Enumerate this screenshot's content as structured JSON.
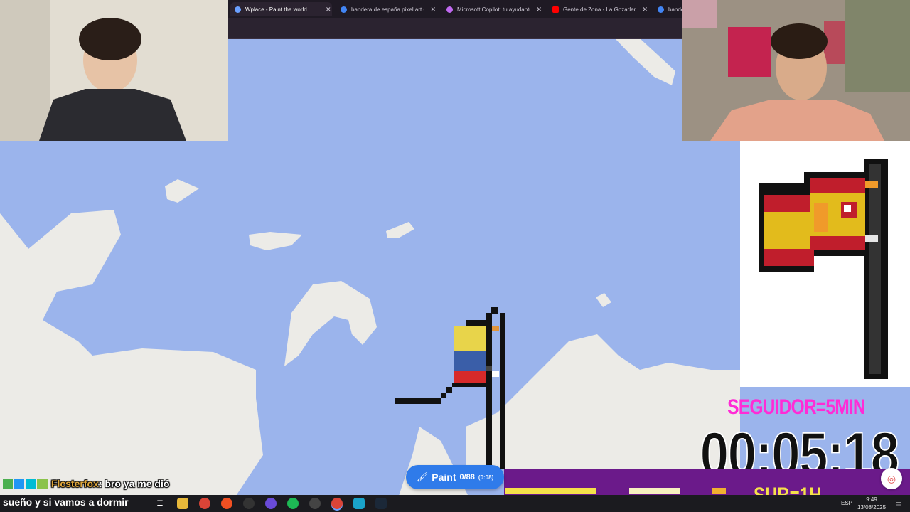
{
  "browser": {
    "tabs": [
      {
        "title": "Wplace - Paint the world",
        "favicon": "wplace-icon",
        "color": "#6aa0ff",
        "active": true
      },
      {
        "title": "bandera de españa pixel art - G",
        "favicon": "google-icon",
        "color": "#4285f4",
        "active": false
      },
      {
        "title": "Microsoft Copilot: tu ayudante",
        "favicon": "copilot-icon",
        "color": "#c069f0",
        "active": false
      },
      {
        "title": "Gente de Zona - La Gozadera (",
        "favicon": "youtube-icon",
        "color": "#ff0000",
        "active": false
      },
      {
        "title": "bande",
        "favicon": "google-icon",
        "color": "#4285f4",
        "active": false
      }
    ]
  },
  "overlay": {
    "seguidor": "SEGUIDOR=5MIN",
    "timer": "00:05:18",
    "sub": "SUB=1H"
  },
  "paint_button": {
    "label": "Paint",
    "count": "0/88",
    "timer": "(0:08)"
  },
  "chat": {
    "user": "Flcsterfox",
    "message_line1": ": bro ya me dió",
    "message_line2": "sueño y si vamos a dormir"
  },
  "taskbar": {
    "lang": "ESP",
    "time": "9:49",
    "date": "13/08/2025"
  },
  "colors": {
    "water": "#9bb4ec",
    "land": "#ecebe7",
    "accent": "#2f7bea",
    "overlay_pink": "#ff2bd6",
    "sub_yellow": "#f5e14a"
  }
}
